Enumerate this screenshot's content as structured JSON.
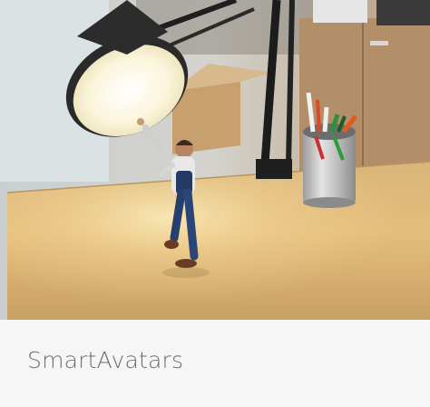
{
  "card": {
    "title": "SmartAvatars",
    "image": {
      "depicts": "animated-character-reaching-for-desk-lamp"
    }
  },
  "colors": {
    "caption_background": "#f6f6f6",
    "caption_text": "#6e6e6e",
    "desk": "#e2b672",
    "lamp_light": "#fbf5dc"
  }
}
